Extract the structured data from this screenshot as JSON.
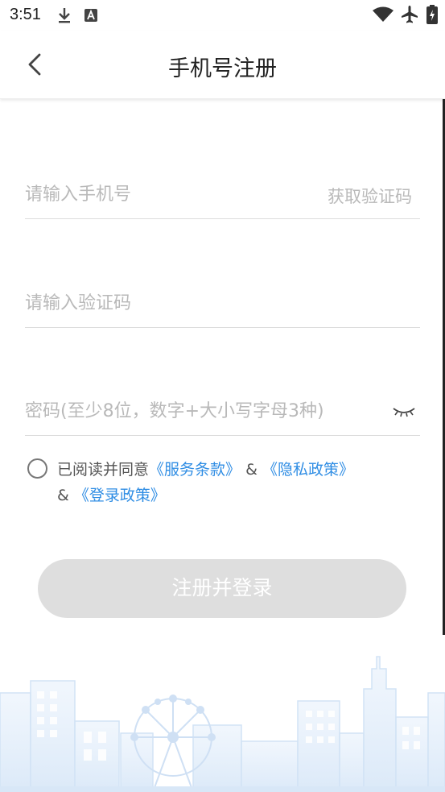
{
  "status_bar": {
    "time": "3:51",
    "left_icons": [
      "download-icon",
      "text-a-icon"
    ],
    "right_icons": [
      "wifi-icon",
      "airplane-mode-icon",
      "battery-icon"
    ]
  },
  "header": {
    "title": "手机号注册",
    "back_icon": "chevron-left-icon"
  },
  "form": {
    "phone_placeholder": "请输入手机号",
    "get_code_label": "获取验证码",
    "code_placeholder": "请输入验证码",
    "password_placeholder": "密码(至少8位，数字+大小写字母3种)",
    "password_toggle_icon": "eye-closed-icon"
  },
  "agreement": {
    "prefix": "已阅读并同意",
    "terms_link": "《服务条款》",
    "amp1": " & ",
    "privacy_link": "《隐私政策》",
    "amp2": "& ",
    "login_policy_link": "《登录政策》"
  },
  "submit_label": "注册并登录",
  "colors": {
    "link": "#2f8de4",
    "placeholder": "#b9b9b9",
    "button_disabled": "#dedede",
    "illustration": "#dbe9f8"
  }
}
